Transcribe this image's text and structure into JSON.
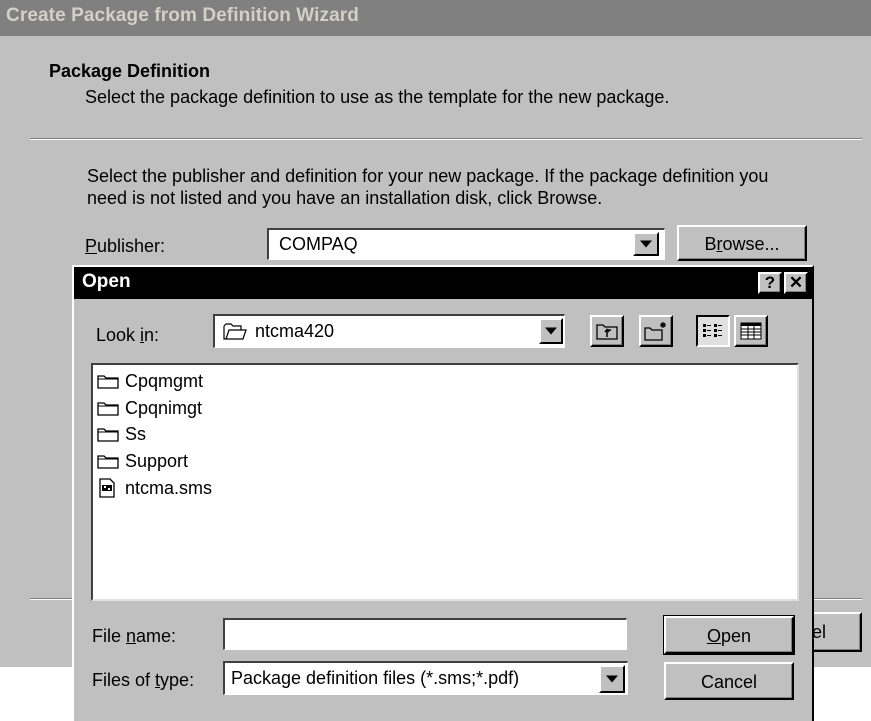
{
  "wizard": {
    "title": "Create Package from Definition Wizard",
    "heading": "Package Definition",
    "subheading": "Select the package definition to use as the template for the new package.",
    "instruction_line1": "Select the publisher and definition for your new package. If the package definition you",
    "instruction_line2": "need is not listed and you have an installation disk, click Browse.",
    "publisher_label": "Publisher:",
    "publisher_value": "COMPAQ",
    "browse_label": "Browse...",
    "cancel_label_partial": "el"
  },
  "open_dialog": {
    "title": "Open",
    "help_label": "?",
    "close_label": "✕",
    "look_in_label": "Look in:",
    "look_in_value": "ntcma420",
    "items": [
      {
        "name": "Cpqmgmt",
        "icon": "folder-icon"
      },
      {
        "name": "Cpqnimgt",
        "icon": "folder-icon"
      },
      {
        "name": "Ss",
        "icon": "folder-icon"
      },
      {
        "name": "Support",
        "icon": "folder-icon"
      },
      {
        "name": "ntcma.sms",
        "icon": "sms-file-icon"
      }
    ],
    "file_name_label": "File name:",
    "file_name_value": "",
    "files_of_type_label": "Files of type:",
    "files_of_type_value": "Package definition files (*.sms;*.pdf)",
    "open_label": "Open",
    "cancel_label": "Cancel"
  },
  "colors": {
    "dialog_face": "#c0c0c0",
    "inactive_titlebar": "#808080",
    "active_titlebar": "#000000"
  }
}
